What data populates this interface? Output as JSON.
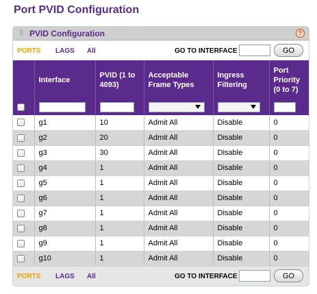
{
  "page": {
    "title": "Port PVID Configuration"
  },
  "panel": {
    "title": "PVID Configuration",
    "help_glyph": "?"
  },
  "toolbar": {
    "links": [
      "PORTS",
      "LAGS",
      "All"
    ],
    "goto_label": "GO TO INTERFACE",
    "goto_value": "",
    "go_label": "GO"
  },
  "table": {
    "headers": {
      "interface": "Interface",
      "pvid": "PVID (1 to 4093)",
      "frame_types": "Acceptable Frame Types",
      "ingress": "Ingress Filtering",
      "priority": "Port Priority (0 to 7)"
    },
    "rows": [
      {
        "interface": "g1",
        "pvid": "10",
        "frame_types": "Admit All",
        "ingress": "Disable",
        "priority": "0"
      },
      {
        "interface": "g2",
        "pvid": "20",
        "frame_types": "Admit All",
        "ingress": "Disable",
        "priority": "0"
      },
      {
        "interface": "g3",
        "pvid": "30",
        "frame_types": "Admit All",
        "ingress": "Disable",
        "priority": "0"
      },
      {
        "interface": "g4",
        "pvid": "1",
        "frame_types": "Admit All",
        "ingress": "Disable",
        "priority": "0"
      },
      {
        "interface": "g5",
        "pvid": "1",
        "frame_types": "Admit All",
        "ingress": "Disable",
        "priority": "0"
      },
      {
        "interface": "g6",
        "pvid": "1",
        "frame_types": "Admit All",
        "ingress": "Disable",
        "priority": "0"
      },
      {
        "interface": "g7",
        "pvid": "1",
        "frame_types": "Admit All",
        "ingress": "Disable",
        "priority": "0"
      },
      {
        "interface": "g8",
        "pvid": "1",
        "frame_types": "Admit All",
        "ingress": "Disable",
        "priority": "0"
      },
      {
        "interface": "g9",
        "pvid": "1",
        "frame_types": "Admit All",
        "ingress": "Disable",
        "priority": "0"
      },
      {
        "interface": "g10",
        "pvid": "1",
        "frame_types": "Admit All",
        "ingress": "Disable",
        "priority": "0"
      }
    ]
  },
  "colors": {
    "brand_purple": "#5b2a8d",
    "active_link": "#e8a200",
    "row_alt": "#d6d6d6"
  }
}
